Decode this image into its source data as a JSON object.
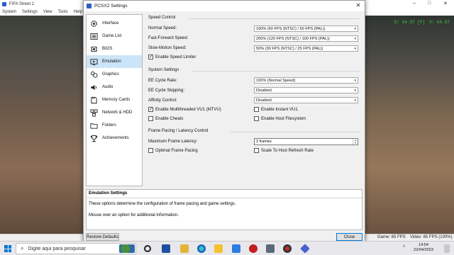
{
  "background_window": {
    "title": "FIFA Street 2",
    "menu": [
      "System",
      "Settings",
      "View",
      "Tools",
      "Help"
    ],
    "overlay_left": "G: 64.97 [P]",
    "overlay_right": "V: 64.97",
    "status_fps": "Game: 65 FPS",
    "status_video": "Video: 65 FPS (100%)"
  },
  "dialog": {
    "title": "PCSX2 Settings",
    "close_glyph": "✕"
  },
  "sidebar": {
    "items": [
      {
        "label": "Interface",
        "icon": "gear-icon"
      },
      {
        "label": "Game List",
        "icon": "list-icon"
      },
      {
        "label": "BIOS",
        "icon": "chip-icon"
      },
      {
        "label": "Emulation",
        "icon": "emulation-icon"
      },
      {
        "label": "Graphics",
        "icon": "graphics-icon"
      },
      {
        "label": "Audio",
        "icon": "speaker-icon"
      },
      {
        "label": "Memory Cards",
        "icon": "memory-card-icon"
      },
      {
        "label": "Network & HDD",
        "icon": "network-icon"
      },
      {
        "label": "Folders",
        "icon": "folder-icon"
      },
      {
        "label": "Achievements",
        "icon": "trophy-icon"
      }
    ],
    "selected": "Emulation"
  },
  "speed_control": {
    "title": "Speed Control",
    "normal_label": "Normal Speed:",
    "normal_value": "100% (60 FPS (NTSC) / 50 FPS (PAL))",
    "ff_label": "Fast-Forward Speed:",
    "ff_value": "200% (120 FPS (NTSC) / 100 FPS (PAL))",
    "slow_label": "Slow-Motion Speed:",
    "slow_value": "50% (30 FPS (NTSC) / 25 FPS (PAL))",
    "limiter_label": "Enable Speed Limiter",
    "limiter_checked": true
  },
  "system_settings": {
    "title": "System Settings",
    "ee_rate_label": "EE Cycle Rate:",
    "ee_rate_value": "100% (Normal Speed)",
    "ee_skip_label": "EE Cycle Skipping:",
    "ee_skip_value": "Disabled",
    "affinity_label": "Affinity Control:",
    "affinity_value": "Disabled",
    "mtvu_label": "Enable Multithreaded VU1 (MTVU)",
    "mtvu_checked": true,
    "instant_vu1_label": "Enable Instant VU1",
    "instant_vu1_checked": false,
    "cheats_label": "Enable Cheats",
    "cheats_checked": false,
    "host_fs_label": "Enable Host Filesystem",
    "host_fs_checked": false
  },
  "frame_pacing": {
    "title": "Frame Pacing / Latency Control",
    "latency_label": "Maximum Frame Latency:",
    "latency_value": "2 frames",
    "optimal_label": "Optimal Frame Pacing",
    "optimal_checked": false,
    "scale_label": "Scale To Host Refresh Rate",
    "scale_checked": false
  },
  "help": {
    "title": "Emulation Settings",
    "description": "These options determine the configuration of frame pacing and game settings.",
    "hint": "Mouse over an option for additional information."
  },
  "buttons": {
    "restore": "Restore Defaults",
    "close": "Close"
  },
  "taskbar": {
    "search_placeholder": "Digite aqui para pesquisar",
    "time": "14:54",
    "date": "22/04/2023",
    "accent": "#0078d7"
  }
}
